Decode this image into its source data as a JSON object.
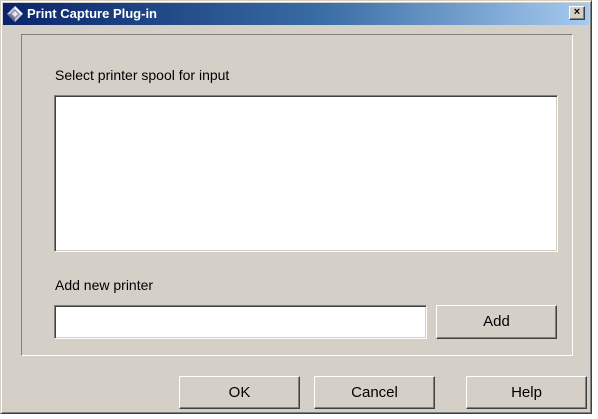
{
  "window": {
    "title": "Print Capture Plug-in",
    "close_label": "×",
    "titlebar_colors": [
      "#0a246a",
      "#a6caf0"
    ],
    "face_color": "#d4d0c8"
  },
  "spool": {
    "label": "Select printer spool for input",
    "items": []
  },
  "new_printer": {
    "label": "Add new printer",
    "value": "",
    "add_label": "Add"
  },
  "footer": {
    "ok_label": "OK",
    "cancel_label": "Cancel",
    "help_label": "Help"
  }
}
